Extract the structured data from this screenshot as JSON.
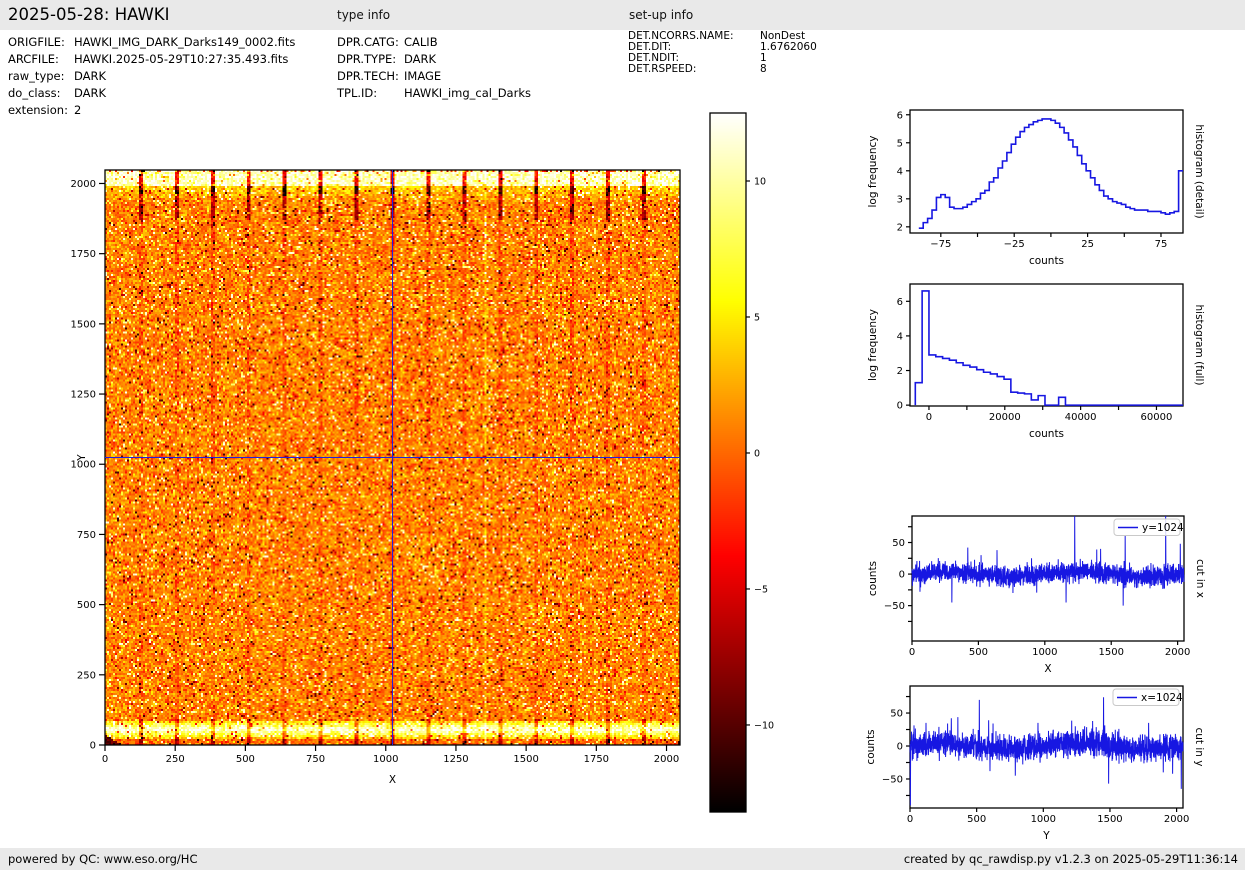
{
  "header": {
    "title": "2025-05-28: HAWKI",
    "type_info_title": "type info",
    "setup_info_title": "set-up info"
  },
  "file_info": {
    "rows": [
      {
        "label": "ORIGFILE:",
        "value": "HAWKI_IMG_DARK_Darks149_0002.fits"
      },
      {
        "label": "ARCFILE:",
        "value": "HAWKI.2025-05-29T10:27:35.493.fits"
      },
      {
        "label": "raw_type:",
        "value": "DARK"
      },
      {
        "label": "do_class:",
        "value": "DARK"
      },
      {
        "label": "extension:",
        "value": "2"
      }
    ]
  },
  "type_info": {
    "rows": [
      {
        "label": "DPR.CATG:",
        "value": "CALIB"
      },
      {
        "label": "DPR.TYPE:",
        "value": "DARK"
      },
      {
        "label": "DPR.TECH:",
        "value": "IMAGE"
      },
      {
        "label": "TPL.ID:",
        "value": "HAWKI_img_cal_Darks"
      }
    ]
  },
  "setup_info": {
    "rows": [
      {
        "label": "DET.NCORRS.NAME:",
        "value": "NonDest"
      },
      {
        "label": "DET.DIT:",
        "value": "1.6762060"
      },
      {
        "label": "DET.NDIT:",
        "value": "1"
      },
      {
        "label": "DET.RSPEED:",
        "value": "8"
      }
    ]
  },
  "footer": {
    "left": "powered by QC: www.eso.org/HC",
    "right": "created by qc_rawdisp.py v1.2.3 on 2025-05-29T11:36:14"
  },
  "colors": {
    "line_blue": "#1717e2",
    "crosshair_blue": "#2121dd",
    "bar_bg": "#e9e9e9",
    "axes_black": "#000000"
  },
  "chart_data": [
    {
      "id": "raw_image",
      "type": "heatmap",
      "xlabel": "X",
      "ylabel": "Y",
      "xlim": [
        0,
        2048
      ],
      "ylim": [
        0,
        2048
      ],
      "xticks": [
        0,
        250,
        500,
        750,
        1000,
        1250,
        1500,
        1750,
        2000
      ],
      "yticks": [
        0,
        250,
        500,
        750,
        1000,
        1250,
        1500,
        1750,
        2000
      ],
      "colormap": "hot",
      "colorbar": {
        "ticks": [
          10,
          5,
          0,
          -5,
          -10
        ],
        "vmin": -13.2,
        "vmax": 12.5
      },
      "crosshair": {
        "x": 1024,
        "y": 1024
      },
      "features": {
        "noise_mean_counts": 0,
        "noise_sigma_counts": 10,
        "top_bright_band_y": [
          1990,
          2048
        ],
        "bottom_bright_band_y": [
          22,
          88
        ],
        "bond_pad_mark_spacing_x": 128,
        "dark_corner_blob": {
          "x": [
            0,
            60
          ],
          "y": [
            0,
            38
          ]
        },
        "faint_light_column_x": 1357
      }
    },
    {
      "id": "histogram_detail",
      "type": "line",
      "right_label": "histogram (detail)",
      "xlabel": "counts",
      "ylabel": "log frequency",
      "xlim": [
        -96,
        90
      ],
      "ylim": [
        1.78,
        6.17
      ],
      "xticks_all": [
        -75,
        -50,
        -25,
        0,
        25,
        50,
        75
      ],
      "xticks_labeled": [
        -75,
        -25,
        25,
        75
      ],
      "yticks_all": [
        2,
        3,
        4,
        5,
        6
      ],
      "yticks_labeled": [
        2,
        3,
        4,
        5,
        6
      ],
      "step": {
        "x0": -90,
        "dx": 3,
        "y": [
          1.95,
          2.15,
          2.3,
          2.6,
          3.05,
          3.15,
          3.05,
          2.7,
          2.65,
          2.65,
          2.7,
          2.8,
          2.9,
          3.0,
          3.2,
          3.3,
          3.6,
          3.75,
          4.1,
          4.35,
          4.65,
          4.95,
          5.2,
          5.4,
          5.55,
          5.65,
          5.75,
          5.8,
          5.85,
          5.85,
          5.8,
          5.7,
          5.55,
          5.35,
          5.1,
          4.85,
          4.55,
          4.25,
          4.0,
          3.75,
          3.5,
          3.3,
          3.1,
          3.0,
          2.9,
          2.85,
          2.8,
          2.7,
          2.65,
          2.6,
          2.6,
          2.6,
          2.55,
          2.55,
          2.55,
          2.5,
          2.45,
          2.5,
          2.55,
          4.0
        ]
      }
    },
    {
      "id": "histogram_full",
      "type": "line",
      "right_label": "histogram (full)",
      "xlabel": "counts",
      "ylabel": "log frequency",
      "xlim": [
        -5000,
        67000
      ],
      "ylim": [
        -0.05,
        7.0
      ],
      "xticks_all": [
        0,
        10000,
        20000,
        30000,
        40000,
        50000,
        60000
      ],
      "xticks_labeled": [
        0,
        20000,
        40000,
        60000
      ],
      "yticks_all": [
        0,
        2,
        4,
        6
      ],
      "yticks_labeled": [
        0,
        2,
        4,
        6
      ],
      "baseline_start": true,
      "step": {
        "x0": -3600,
        "dx": 1800,
        "y": [
          1.3,
          6.6,
          2.9,
          2.8,
          2.7,
          2.6,
          2.45,
          2.3,
          2.2,
          2.05,
          1.9,
          1.8,
          1.65,
          1.5,
          0.75,
          0.7,
          0.65,
          0.3,
          0.55,
          0,
          0,
          0.45,
          0,
          0,
          0,
          0,
          0,
          0,
          0,
          0,
          0,
          0,
          0,
          0,
          0,
          0,
          0,
          0,
          0,
          0,
          0
        ]
      }
    },
    {
      "id": "cut_x",
      "type": "line",
      "legend": "y=1024",
      "right_label": "cut in x",
      "xlabel": "X",
      "ylabel": "counts",
      "xlim": [
        0,
        2048
      ],
      "ylim": [
        -106,
        92
      ],
      "xticks_all": [
        0,
        500,
        1000,
        1500,
        2000
      ],
      "xticks_labeled": [
        0,
        500,
        1000,
        1500,
        2000
      ],
      "yticks_all": [
        -75,
        -50,
        -25,
        0,
        25,
        50,
        75
      ],
      "yticks_labeled": [
        -50,
        0,
        50
      ],
      "noise": {
        "sd": 8,
        "wave": 4,
        "seed": 101,
        "n": 2048
      },
      "spikes": [
        [
          60,
          -28
        ],
        [
          300,
          -45
        ],
        [
          420,
          42
        ],
        [
          520,
          30
        ],
        [
          640,
          38
        ],
        [
          760,
          -30
        ],
        [
          900,
          25
        ],
        [
          1160,
          -45
        ],
        [
          1225,
          115
        ],
        [
          1420,
          40
        ],
        [
          1590,
          -50
        ],
        [
          1605,
          62
        ],
        [
          1910,
          100
        ],
        [
          2020,
          48
        ]
      ]
    },
    {
      "id": "cut_y",
      "type": "line",
      "legend": "x=1024",
      "right_label": "cut in y",
      "xlabel": "Y",
      "ylabel": "counts",
      "xlim": [
        0,
        2048
      ],
      "ylim": [
        -94,
        91
      ],
      "xticks_all": [
        0,
        500,
        1000,
        1500,
        2000
      ],
      "xticks_labeled": [
        0,
        500,
        1000,
        1500,
        2000
      ],
      "yticks_all": [
        -75,
        -50,
        -25,
        0,
        25,
        50,
        75
      ],
      "yticks_labeled": [
        -50,
        0,
        50
      ],
      "noise": {
        "sd": 10,
        "wave": 5,
        "seed": 202,
        "n": 2048
      },
      "spikes": [
        [
          3,
          -90
        ],
        [
          120,
          35
        ],
        [
          310,
          42
        ],
        [
          520,
          70
        ],
        [
          600,
          -38
        ],
        [
          790,
          -45
        ],
        [
          960,
          35
        ],
        [
          1240,
          30
        ],
        [
          1370,
          38
        ],
        [
          1452,
          74
        ],
        [
          1490,
          -57
        ],
        [
          1790,
          35
        ],
        [
          1900,
          -40
        ],
        [
          1970,
          -42
        ],
        [
          2035,
          -65
        ]
      ]
    }
  ]
}
